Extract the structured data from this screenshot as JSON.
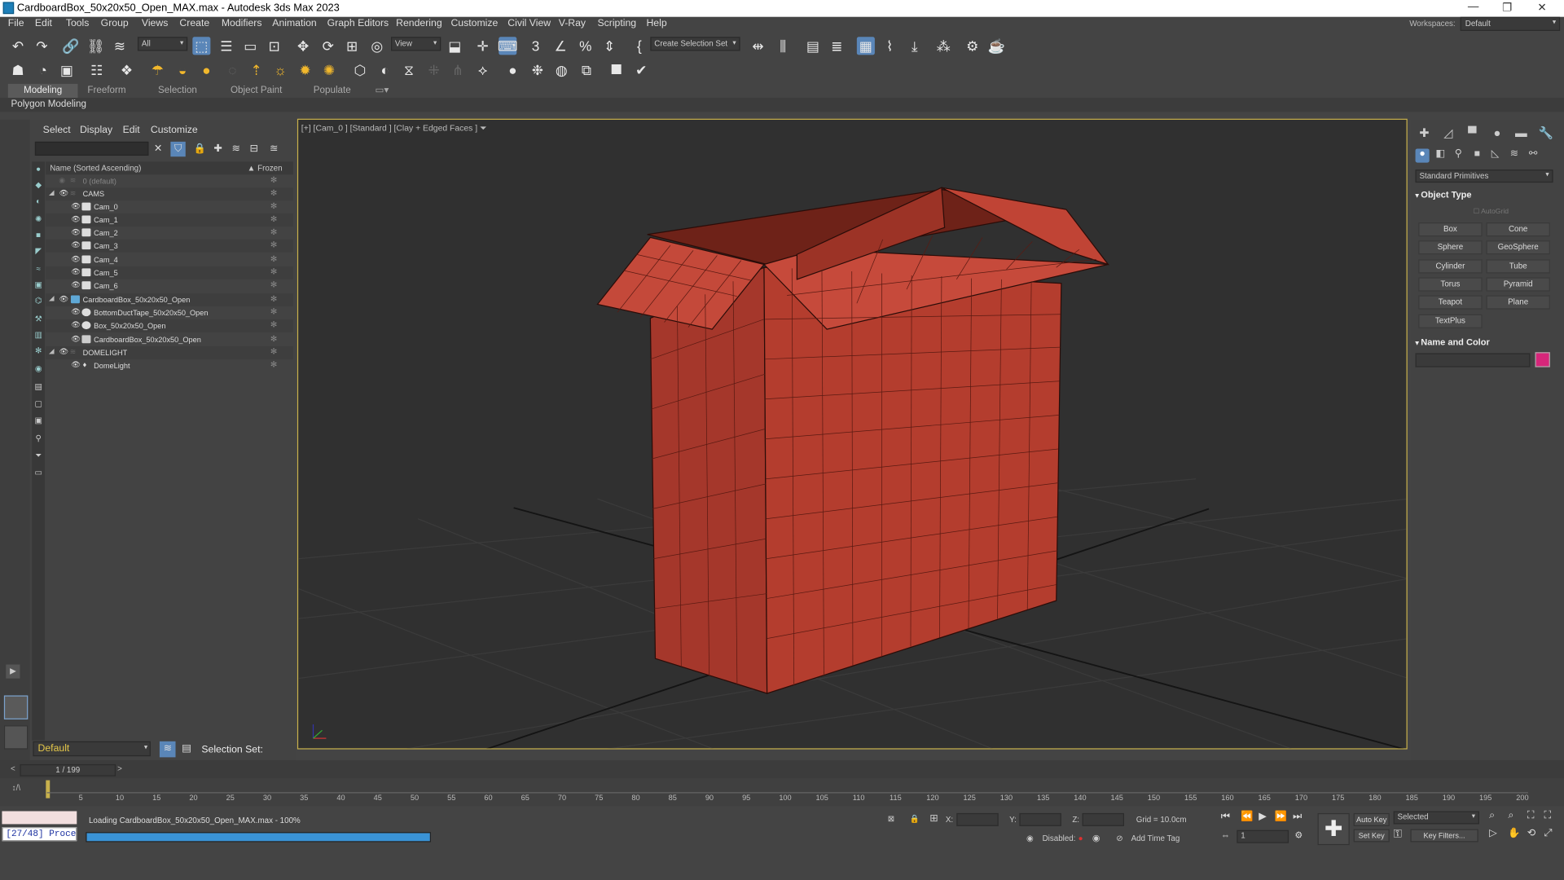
{
  "window": {
    "title": "CardboardBox_50x20x50_Open_MAX.max - Autodesk 3ds Max 2023"
  },
  "menu": [
    "File",
    "Edit",
    "Tools",
    "Group",
    "Views",
    "Create",
    "Modifiers",
    "Animation",
    "Graph Editors",
    "Rendering",
    "Customize",
    "Civil View",
    "V-Ray",
    "Scripting",
    "Help"
  ],
  "workspaces": {
    "label": "Workspaces:",
    "value": "Default"
  },
  "toolbar": {
    "selection_filter": "All",
    "ref_coord": "View",
    "selection_set": "Create Selection Set"
  },
  "ribbon": {
    "tabs": [
      "Modeling",
      "Freeform",
      "Selection",
      "Object Paint",
      "Populate"
    ],
    "active": "Modeling",
    "sub": "Polygon Modeling"
  },
  "scene_explorer": {
    "menus": [
      "Select",
      "Display",
      "Edit",
      "Customize"
    ],
    "header_name": "Name (Sorted Ascending)",
    "header_frozen": "▲ Frozen",
    "rows": [
      {
        "label": "0 (default)",
        "level": 1
      },
      {
        "label": "CAMS",
        "level": 0
      },
      {
        "label": "Cam_0",
        "level": 2
      },
      {
        "label": "Cam_1",
        "level": 2
      },
      {
        "label": "Cam_2",
        "level": 2
      },
      {
        "label": "Cam_3",
        "level": 2
      },
      {
        "label": "Cam_4",
        "level": 2
      },
      {
        "label": "Cam_5",
        "level": 2
      },
      {
        "label": "Cam_6",
        "level": 2
      },
      {
        "label": "CardboardBox_50x20x50_Open",
        "level": 0
      },
      {
        "label": "BottomDuctTape_50x20x50_Open",
        "level": 2
      },
      {
        "label": "Box_50x20x50_Open",
        "level": 2
      },
      {
        "label": "CardboardBox_50x20x50_Open",
        "level": 2
      },
      {
        "label": "DOMELIGHT",
        "level": 0
      },
      {
        "label": "DomeLight",
        "level": 2
      }
    ],
    "layer": "Default",
    "selection_set_label": "Selection Set:"
  },
  "viewport": {
    "label": "[+] [Cam_0 ] [Standard ] [Clay + Edged Faces ]"
  },
  "command_panel": {
    "dropdown": "Standard Primitives",
    "object_type": "Object Type",
    "autogrid": "AutoGrid",
    "buttons": [
      "Box",
      "Cone",
      "Sphere",
      "GeoSphere",
      "Cylinder",
      "Tube",
      "Torus",
      "Pyramid",
      "Teapot",
      "Plane",
      "TextPlus"
    ],
    "name_and_color": "Name and Color",
    "color": "#d6267a"
  },
  "timeline": {
    "slider": "1 / 199",
    "ticks": [
      "5",
      "10",
      "15",
      "20",
      "25",
      "30",
      "35",
      "40",
      "45",
      "50",
      "55",
      "60",
      "65",
      "70",
      "75",
      "80",
      "85",
      "90",
      "95",
      "100",
      "105",
      "110",
      "115",
      "120",
      "125",
      "130",
      "135",
      "140",
      "145",
      "150",
      "155",
      "160",
      "165",
      "170",
      "175",
      "180",
      "185",
      "190",
      "195",
      "200"
    ]
  },
  "status": {
    "maxscript_output": "[27/48] Proces",
    "loading": "Loading CardboardBox_50x20x50_Open_MAX.max  -  100%",
    "progress": 1.0,
    "x": "X:",
    "y": "Y:",
    "z": "Z:",
    "grid": "Grid = 10.0cm",
    "disabled": "Disabled:",
    "add_time_tag": "Add Time Tag",
    "auto_key": "Auto Key",
    "selected": "Selected",
    "set_key": "Set Key",
    "key_filters": "Key Filters...",
    "frame": "1"
  }
}
